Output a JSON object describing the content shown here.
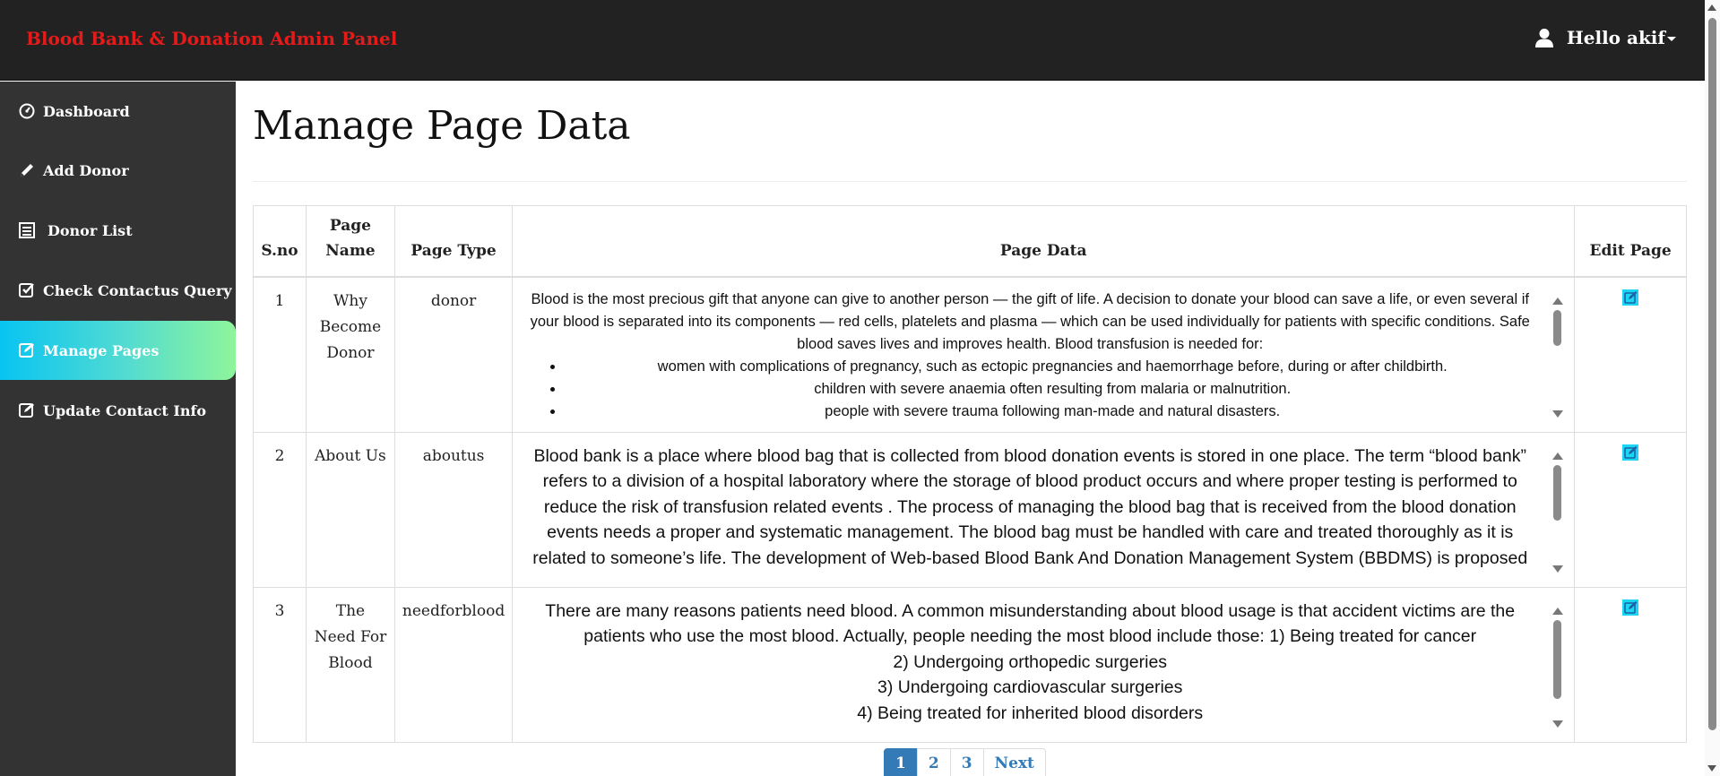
{
  "brand": "Blood Bank & Donation Admin Panel",
  "user": {
    "greeting": "Hello akif"
  },
  "colors": {
    "brand": "#e31b1b",
    "active_from": "#08c4f2",
    "active_to": "#8ef59a",
    "link": "#337ab7"
  },
  "sidebar": {
    "items": [
      {
        "label": "Dashboard",
        "icon": "dashboard-icon"
      },
      {
        "label": "Add Donor",
        "icon": "pencil-icon"
      },
      {
        "label": "Donor List",
        "icon": "list-icon"
      },
      {
        "label": "Check Contactus Query",
        "icon": "check-square-icon"
      },
      {
        "label": "Manage Pages",
        "icon": "edit-square-icon",
        "active": true
      },
      {
        "label": "Update Contact Info",
        "icon": "edit-square-icon"
      }
    ]
  },
  "main": {
    "title": "Manage Page Data",
    "table": {
      "headers": [
        "S.no",
        "Page Name",
        "Page Type",
        "Page Data",
        "Edit Page"
      ],
      "rows": [
        {
          "sno": "1",
          "name": "Why Become Donor",
          "type": "donor",
          "data_intro": "Blood is the most precious gift that anyone can give to another person — the gift of life. A decision to donate your blood can save a life, or even several if your blood is separated into its components — red cells, platelets and plasma — which can be used individually for patients with specific conditions. Safe blood saves lives and improves health. Blood transfusion is needed for:",
          "data_bullets": [
            "women with complications of pregnancy, such as ectopic pregnancies and haemorrhage before, during or after childbirth.",
            "children with severe anaemia often resulting from malaria or malnutrition.",
            "people with severe trauma following man-made and natural disasters."
          ]
        },
        {
          "sno": "2",
          "name": "About Us",
          "type": "aboutus",
          "data": "Blood bank is a place where blood bag that is collected from blood donation events is stored in one place. The term “blood bank” refers to a division of a hospital laboratory where the storage of blood product occurs and where proper testing is performed to reduce the risk of transfusion related events . The process of managing the blood bag that is received from the blood donation events needs a proper and systematic management. The blood bag must be handled with care and treated thoroughly as it is related to someone’s life. The development of Web-based Blood Bank And Donation Management System (BBDMS) is proposed"
        },
        {
          "sno": "3",
          "name": "The Need For Blood",
          "type": "needforblood",
          "data_lines": [
            "There are many reasons patients need blood. A common misunderstanding about blood usage is that accident victims are the patients who use the most blood. Actually, people needing the most blood include those: 1) Being treated for cancer",
            "2) Undergoing orthopedic surgeries",
            "3) Undergoing cardiovascular surgeries",
            "4) Being treated for inherited blood disorders"
          ]
        }
      ]
    },
    "pagination": {
      "pages": [
        "1",
        "2",
        "3"
      ],
      "active": "1",
      "next": "Next"
    }
  }
}
